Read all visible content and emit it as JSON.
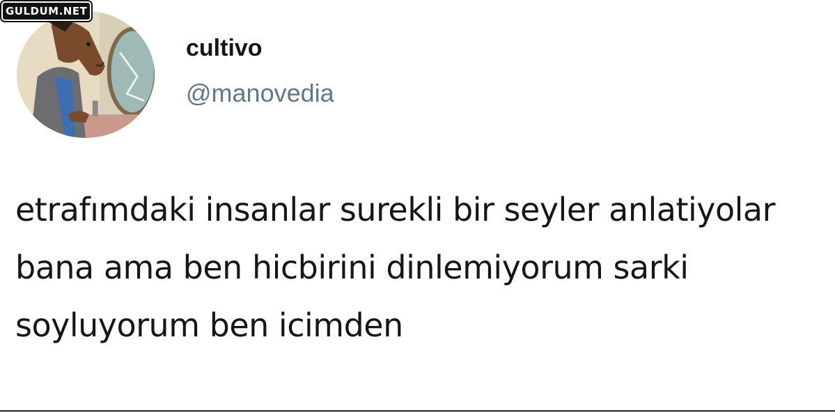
{
  "watermark": {
    "text": "GULDUM.NET"
  },
  "tweet": {
    "display_name": "cultivo",
    "handle": "@manovedia",
    "text": "etrafımdaki insanlar surekli bir seyler anlatiyolar bana ama ben hicbirini dinlemiyorum sarki soyluyorum ben icimden"
  },
  "avatar": {
    "icon": "bojack-horseman-avatar"
  }
}
